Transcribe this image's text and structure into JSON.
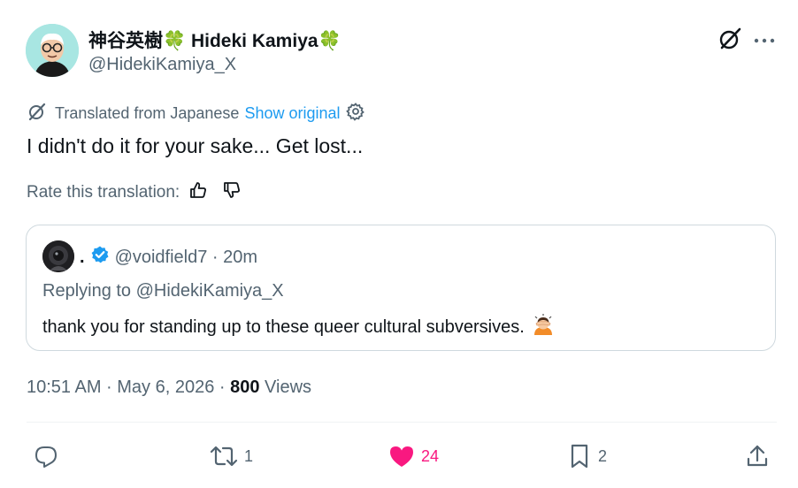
{
  "author": {
    "display_name": "神谷英樹🍀 Hideki Kamiya🍀",
    "handle": "@HidekiKamiya_X"
  },
  "translation": {
    "notice": "Translated from Japanese",
    "show_original": "Show original"
  },
  "tweet": {
    "text": "I didn't do it for your sake... Get lost..."
  },
  "rate": {
    "label": "Rate this translation:"
  },
  "quoted": {
    "display_name": ".",
    "meta": "@voidfield7 · 20m",
    "replying_to": "Replying to @HidekiKamiya_X",
    "text": "thank you for standing up to these queer cultural subversives."
  },
  "meta": {
    "time_date": "10:51 AM · May 6, 2026 · ",
    "views_count": "800",
    "views_label": " Views"
  },
  "actions": {
    "replies": "",
    "reposts": "1",
    "likes": "24",
    "bookmarks": "2"
  },
  "colors": {
    "like": "#f91880",
    "link": "#1d9bf0",
    "verified": "#1d9bf0",
    "muted": "#536471"
  },
  "icons": [
    "grok-icon",
    "more-icon",
    "translate-icon",
    "settings-gear-icon",
    "thumbs-up-icon",
    "thumbs-down-icon",
    "verified-badge-icon",
    "facepalm-emoji-icon",
    "reply-icon",
    "repost-icon",
    "heart-icon",
    "bookmark-icon",
    "share-icon"
  ]
}
